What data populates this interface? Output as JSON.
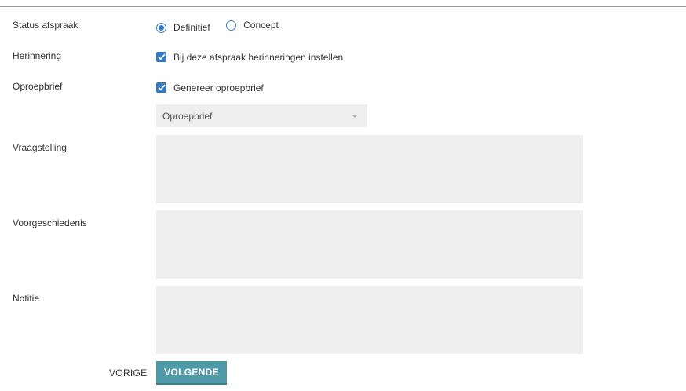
{
  "form": {
    "status": {
      "label": "Status afspraak",
      "options": [
        {
          "label": "Definitief",
          "selected": true
        },
        {
          "label": "Concept",
          "selected": false
        }
      ]
    },
    "reminder": {
      "label": "Herinnering",
      "checkbox_label": "Bij deze afspraak herinneringen instellen",
      "checked": true
    },
    "letter": {
      "label": "Oproepbrief",
      "checkbox_label": "Genereer oproepbrief",
      "checked": true,
      "select_value": "Oproepbrief"
    },
    "question": {
      "label": "Vraagstelling",
      "value": ""
    },
    "history": {
      "label": "Voorgeschiedenis",
      "value": ""
    },
    "note": {
      "label": "Notitie",
      "value": ""
    }
  },
  "buttons": {
    "previous": "VORIGE",
    "next": "VOLGENDE"
  },
  "colors": {
    "accent": "#4e9aa8",
    "checkbox": "#3478c6",
    "field_background": "#eeeeee"
  }
}
